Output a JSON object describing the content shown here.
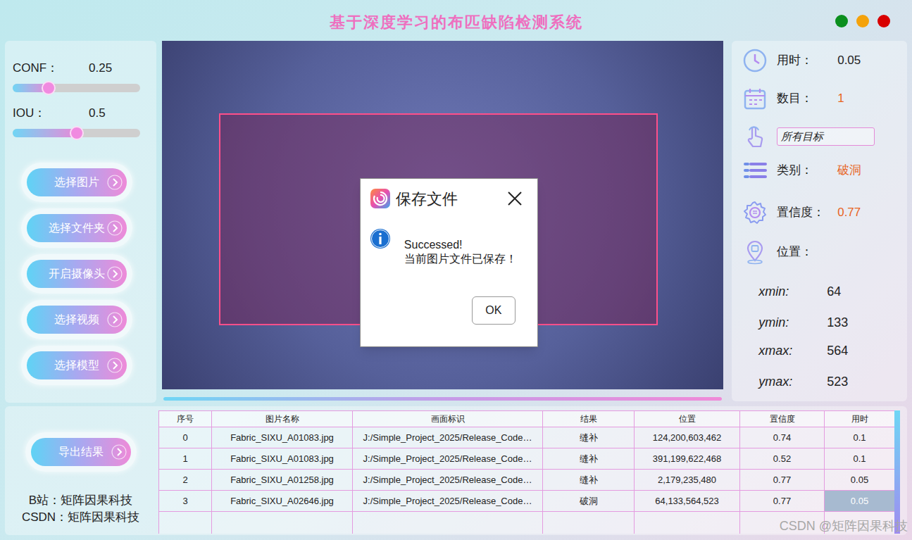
{
  "window": {
    "title": "基于深度学习的布匹缺陷检测系统",
    "controls": [
      {
        "color": "#0b8f1e"
      },
      {
        "color": "#f4a20b"
      },
      {
        "color": "#d80000"
      }
    ]
  },
  "sliders": [
    {
      "label": "CONF：",
      "value": "0.25",
      "level": 0.28
    },
    {
      "label": "IOU：",
      "value": "0.5",
      "level": 0.5
    }
  ],
  "actions": [
    {
      "label": "选择图片"
    },
    {
      "label": "选择文件夹"
    },
    {
      "label": "开启摄像头"
    },
    {
      "label": "选择视频"
    },
    {
      "label": "选择模型"
    }
  ],
  "progress": {
    "level": 1
  },
  "dialog": {
    "title": "保存文件",
    "heading": "Successed!",
    "message": "当前图片文件已保存！",
    "button": "OK"
  },
  "result": {
    "time_label": "用时：",
    "time": "0.05",
    "count_label": "数目：",
    "count": "1",
    "filter": "所有目标",
    "class_label": "类别：",
    "class": "破洞",
    "conf_label": "置信度：",
    "conf": "0.77",
    "position_label": "位置：",
    "coords": [
      {
        "label": "xmin:",
        "value": "64"
      },
      {
        "label": "ymin:",
        "value": "133"
      },
      {
        "label": "xmax:",
        "value": "564"
      },
      {
        "label": "ymax:",
        "value": "523"
      }
    ]
  },
  "export": {
    "label": "导出结果"
  },
  "credits": [
    "B站：矩阵因果科技",
    "CSDN：矩阵因果科技"
  ],
  "table": {
    "columns": [
      "序号",
      "图片名称",
      "画面标识",
      "结果",
      "位置",
      "置信度",
      "用时"
    ],
    "rows": [
      {
        "cells": [
          {
            "text": "0",
            "selected": false
          },
          {
            "text": "Fabric_SIXU_A01083.jpg",
            "selected": false
          },
          {
            "text": "J:/Simple_Project_2025/Release_Code…",
            "selected": false
          },
          {
            "text": "缝补",
            "selected": false
          },
          {
            "text": "124,200,603,462",
            "selected": false
          },
          {
            "text": "0.74",
            "selected": false
          },
          {
            "text": "0.1",
            "selected": false
          }
        ]
      },
      {
        "cells": [
          {
            "text": "1",
            "selected": false
          },
          {
            "text": "Fabric_SIXU_A01083.jpg",
            "selected": false
          },
          {
            "text": "J:/Simple_Project_2025/Release_Code…",
            "selected": false
          },
          {
            "text": "缝补",
            "selected": false
          },
          {
            "text": "391,199,622,468",
            "selected": false
          },
          {
            "text": "0.52",
            "selected": false
          },
          {
            "text": "0.1",
            "selected": false
          }
        ]
      },
      {
        "cells": [
          {
            "text": "2",
            "selected": false
          },
          {
            "text": "Fabric_SIXU_A01258.jpg",
            "selected": false
          },
          {
            "text": "J:/Simple_Project_2025/Release_Code…",
            "selected": false
          },
          {
            "text": "缝补",
            "selected": false
          },
          {
            "text": "2,179,235,480",
            "selected": false
          },
          {
            "text": "0.77",
            "selected": false
          },
          {
            "text": "0.05",
            "selected": false
          }
        ]
      },
      {
        "cells": [
          {
            "text": "3",
            "selected": false
          },
          {
            "text": "Fabric_SIXU_A02646.jpg",
            "selected": false
          },
          {
            "text": "J:/Simple_Project_2025/Release_Code…",
            "selected": false
          },
          {
            "text": "破洞",
            "selected": false
          },
          {
            "text": "64,133,564,523",
            "selected": false
          },
          {
            "text": "0.77",
            "selected": false
          },
          {
            "text": "0.05",
            "selected": true
          }
        ]
      }
    ]
  },
  "watermark": "CSDN @矩阵因果科技"
}
